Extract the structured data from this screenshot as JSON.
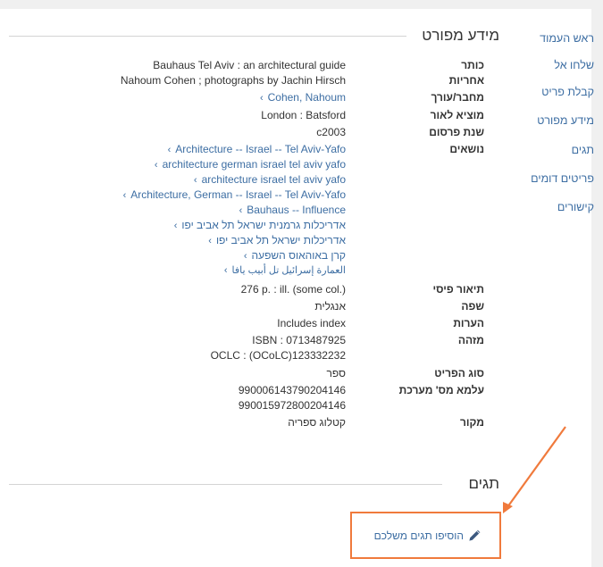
{
  "nav": {
    "items": [
      {
        "label": "ראש העמוד"
      },
      {
        "label": "שלחו אל"
      },
      {
        "label": "קבלת פריט"
      },
      {
        "label": "מידע מפורט"
      },
      {
        "label": "תגים"
      },
      {
        "label": "פריטים דומים"
      },
      {
        "label": "קישורים"
      }
    ]
  },
  "details": {
    "title": "מידע מפורט",
    "fields": {
      "title_label": "כותר",
      "title_value": "Bauhaus Tel Aviv : an architectural guide",
      "resp_label": "אחריות",
      "resp_value": "Nahoum Cohen ; photographs by Jachin Hirsch",
      "author_label": "מחבר/עורך",
      "author_value": "Cohen, Nahoum",
      "publisher_label": "מוציא לאור",
      "publisher_value": "London : Batsford",
      "year_label": "שנת פרסום",
      "year_value": "c2003",
      "subjects_label": "נושאים",
      "subjects": [
        "Architecture -- Israel -- Tel Aviv-Yafo",
        "architecture german israel tel aviv yafo",
        "architecture israel tel aviv yafo",
        "Architecture, German -- Israel -- Tel Aviv-Yafo",
        "Bauhaus -- Influence",
        "אדריכלות גרמנית ישראל תל אביב יפו",
        "אדריכלות ישראל תל אביב יפו",
        "קרן באוהאוס השפעה",
        "العمارة إسرائيل تل أبيب يافا"
      ],
      "physical_label": "תיאור פיסי",
      "physical_value": "276 p. : ill. (some col.)",
      "language_label": "שפה",
      "language_value": "אנגלית",
      "notes_label": "הערות",
      "notes_value": "Includes index",
      "identifier_label": "מזהה",
      "isbn_value": "ISBN : 0713487925",
      "oclc_value": "OCLC : (OCoLC)123332232",
      "type_label": "סוג הפריט",
      "type_value": "ספר",
      "system_label": "עלמא מס' מערכת",
      "system_values": [
        "990006143790204146",
        "990015972800204146"
      ],
      "source_label": "מקור",
      "source_value": "קטלוג ספריה"
    }
  },
  "tags": {
    "title": "תגים",
    "add_label": "הוסיפו תגים משלכם"
  },
  "colors": {
    "link": "#3d6ea3",
    "highlight": "#f07a3c",
    "background": "#f0f0f0"
  }
}
